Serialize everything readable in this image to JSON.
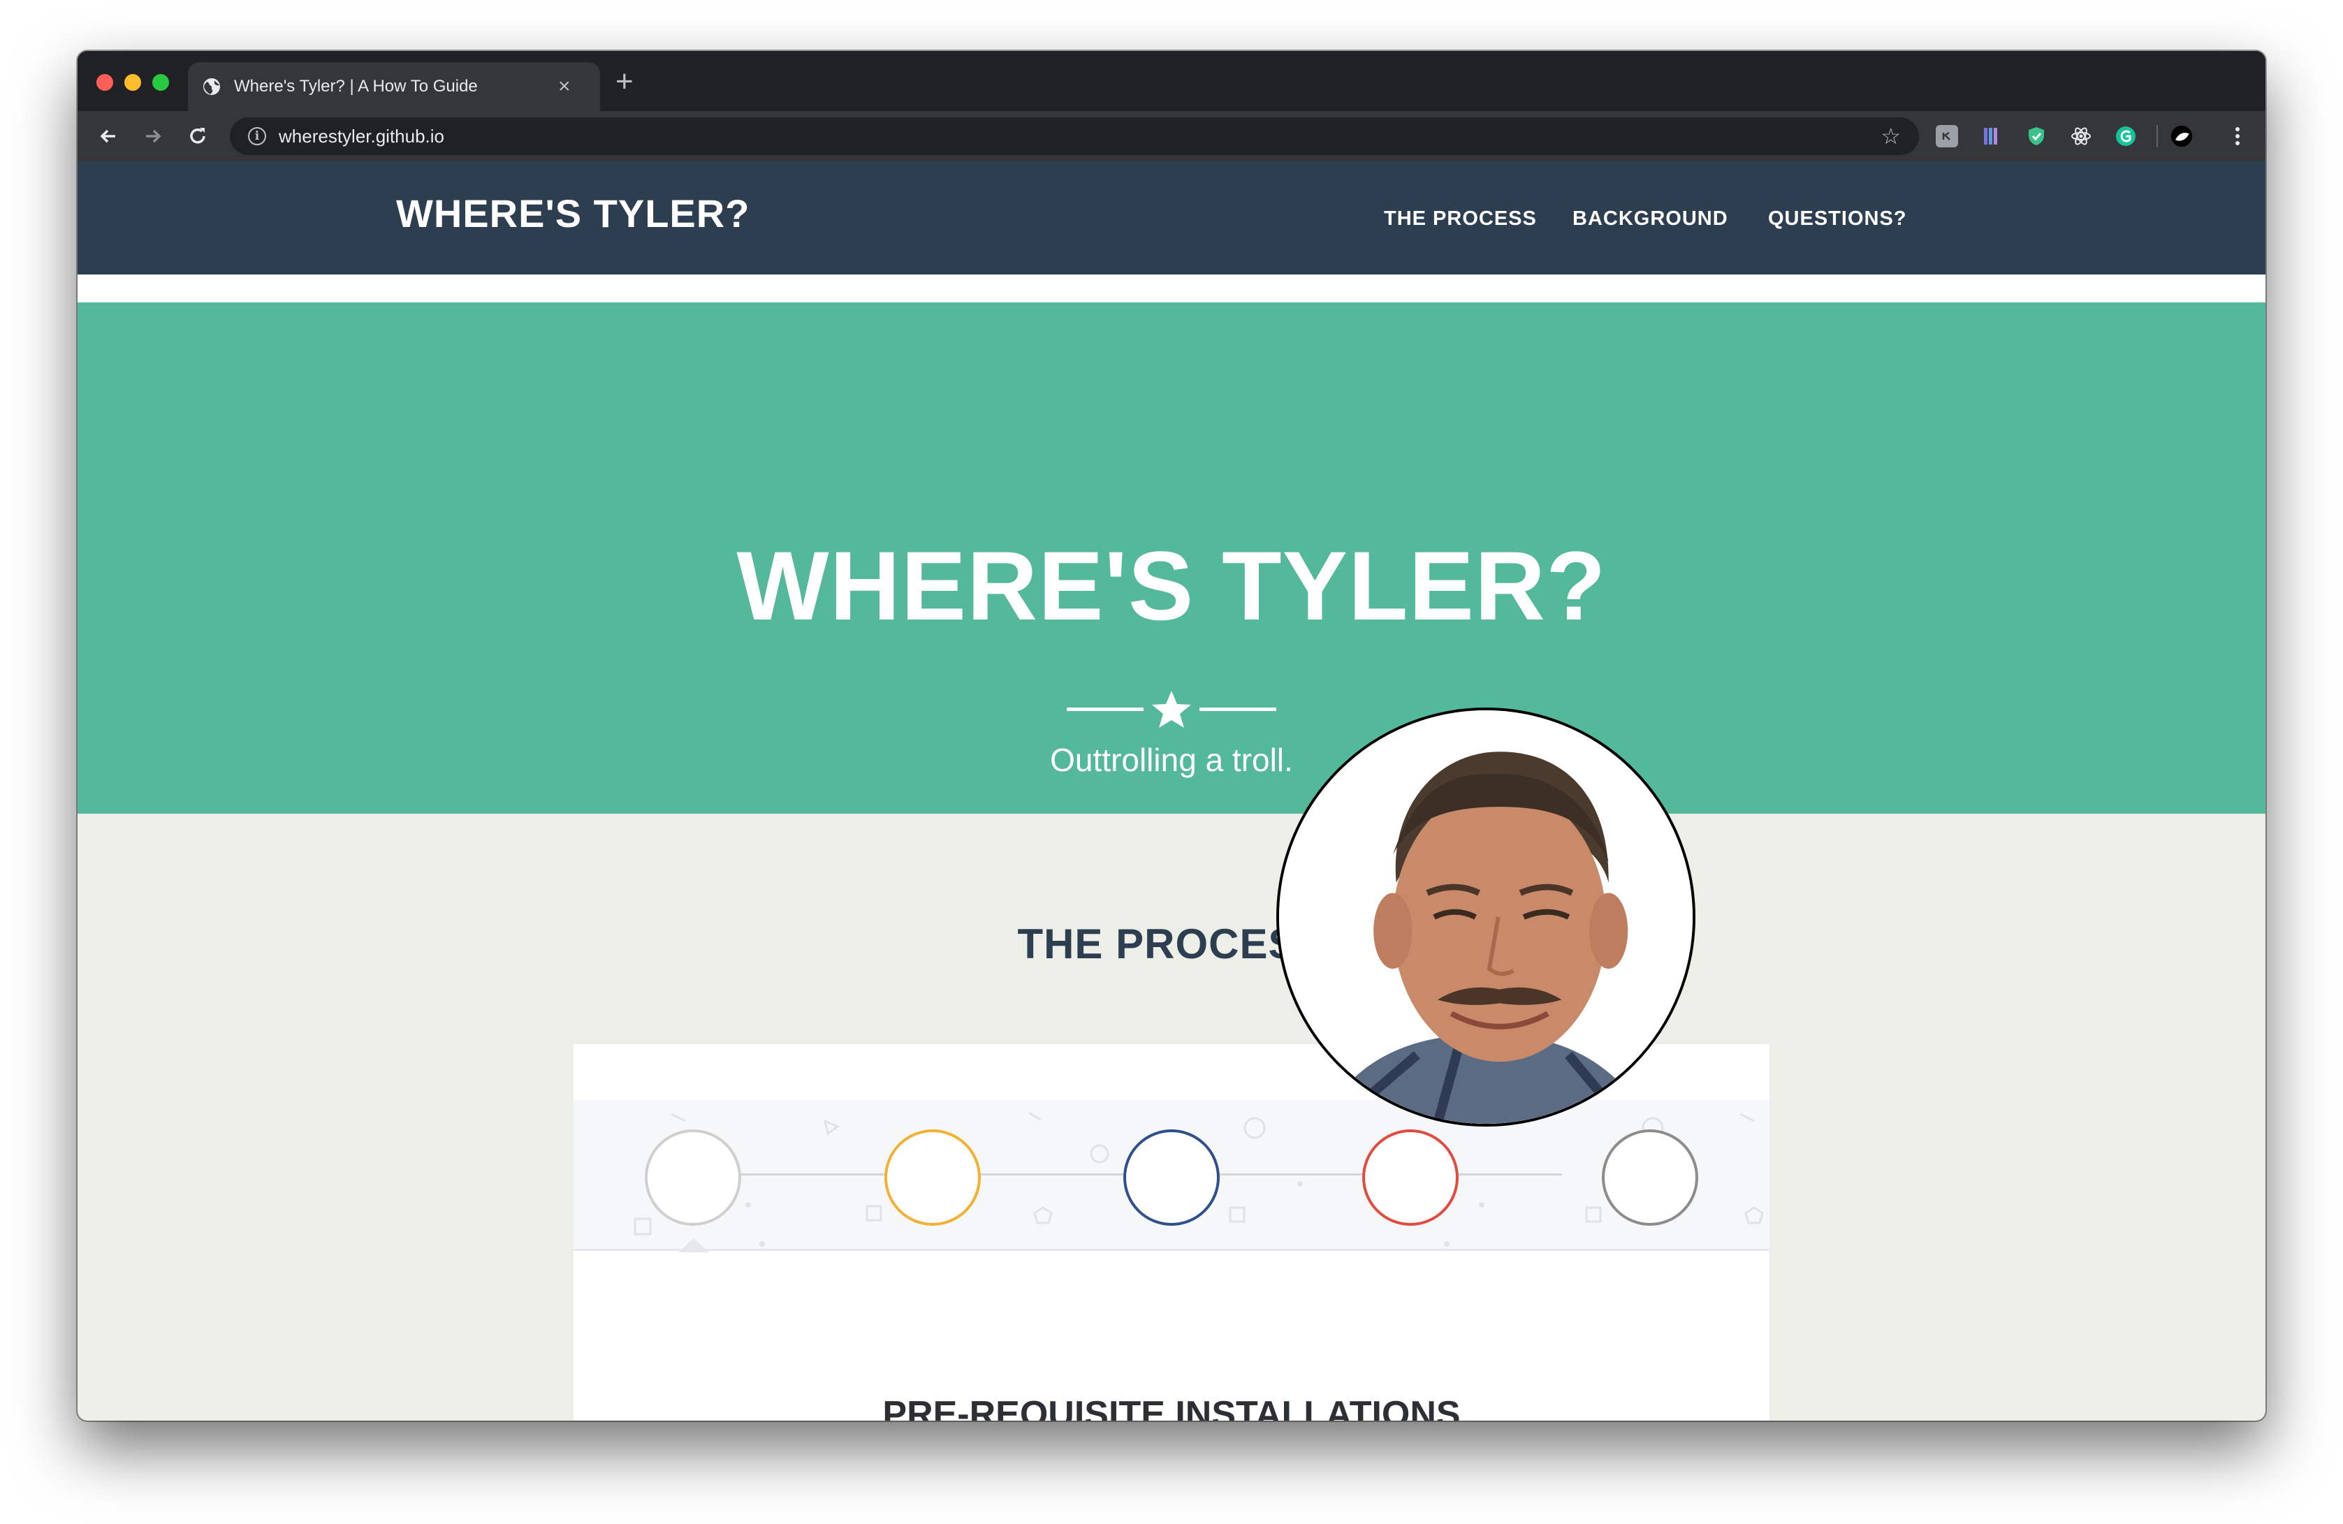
{
  "browser": {
    "tab_title": "Where's Tyler? | A How To Guide",
    "tab_close": "×",
    "new_tab": "+",
    "url": "wherestyler.github.io",
    "info_glyph": "i",
    "bookmark_glyph": "☆"
  },
  "site": {
    "brand": "WHERE'S TYLER?",
    "nav": [
      {
        "label": "THE PROCESS"
      },
      {
        "label": "BACKGROUND"
      },
      {
        "label": "QUESTIONS?"
      }
    ],
    "hero": {
      "title": "WHERE'S TYLER?",
      "tagline": "Outtrolling a troll."
    },
    "process": {
      "title": "THE PROCESS",
      "steps": [
        {
          "color": "#cfcfcf"
        },
        {
          "color": "#f2b134"
        },
        {
          "color": "#2f4f8f"
        },
        {
          "color": "#e04c3f"
        },
        {
          "color": "#8c8c8c"
        }
      ],
      "card_heading": "PRE-REQUISITE INSTALLATIONS"
    }
  },
  "colors": {
    "nav_bg": "#2c3e50",
    "hero_bg": "#54b89b",
    "page_bg": "#eeeee8"
  }
}
